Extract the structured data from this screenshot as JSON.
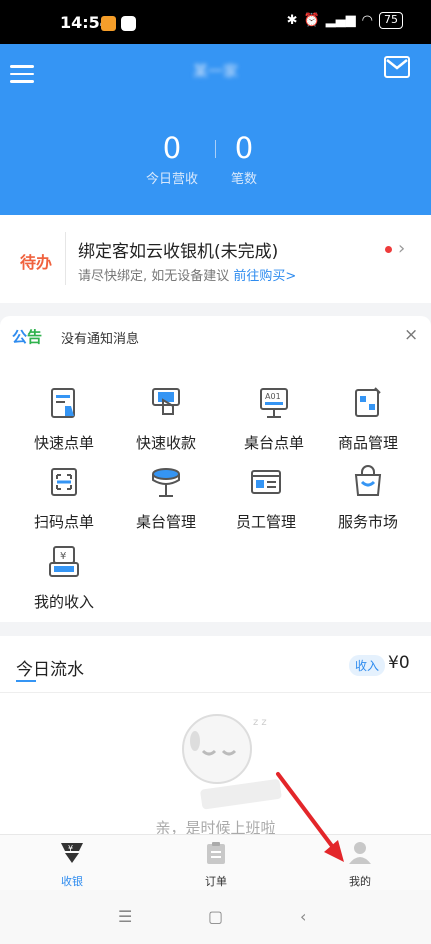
{
  "status_bar": {
    "time": "14:54",
    "battery": "75"
  },
  "header": {
    "shop_name": "某一家",
    "stats": [
      {
        "value": "0",
        "label": "今日营收"
      },
      {
        "value": "0",
        "label": "笔数"
      }
    ]
  },
  "todo": {
    "badge": "待办",
    "title": "绑定客如云收银机(未完成)",
    "subtitle": "请尽快绑定, 如无设备建议",
    "link": "前往购买>"
  },
  "notice": {
    "tag_left": "公",
    "tag_right": "告",
    "text": "没有通知消息",
    "close": "×"
  },
  "grid": {
    "items": [
      {
        "label": "快速点单",
        "icon": "quick-order-icon"
      },
      {
        "label": "快速收款",
        "icon": "quick-payment-icon"
      },
      {
        "label": "桌台点单",
        "icon": "table-order-icon"
      },
      {
        "label": "商品管理",
        "icon": "product-management-icon"
      },
      {
        "label": "扫码点单",
        "icon": "scan-order-icon"
      },
      {
        "label": "桌台管理",
        "icon": "table-management-icon"
      },
      {
        "label": "员工管理",
        "icon": "staff-management-icon"
      },
      {
        "label": "服务市场",
        "icon": "service-market-icon"
      },
      {
        "label": "我的收入",
        "icon": "my-income-icon"
      }
    ]
  },
  "flow": {
    "title": "今日流水",
    "tag": "收入",
    "amount": "¥0"
  },
  "empty": {
    "text": "亲，是时候上班啦"
  },
  "tabbar": {
    "tabs": [
      {
        "label": "收银",
        "icon": "cashier-icon",
        "active": true
      },
      {
        "label": "订单",
        "icon": "order-icon",
        "active": false
      },
      {
        "label": "我的",
        "icon": "profile-icon",
        "active": false
      }
    ]
  },
  "colors": {
    "brand": "#3595f4",
    "accent": "#2f8cef",
    "todo_badge": "#f0623e",
    "arrow": "#e3262a"
  }
}
